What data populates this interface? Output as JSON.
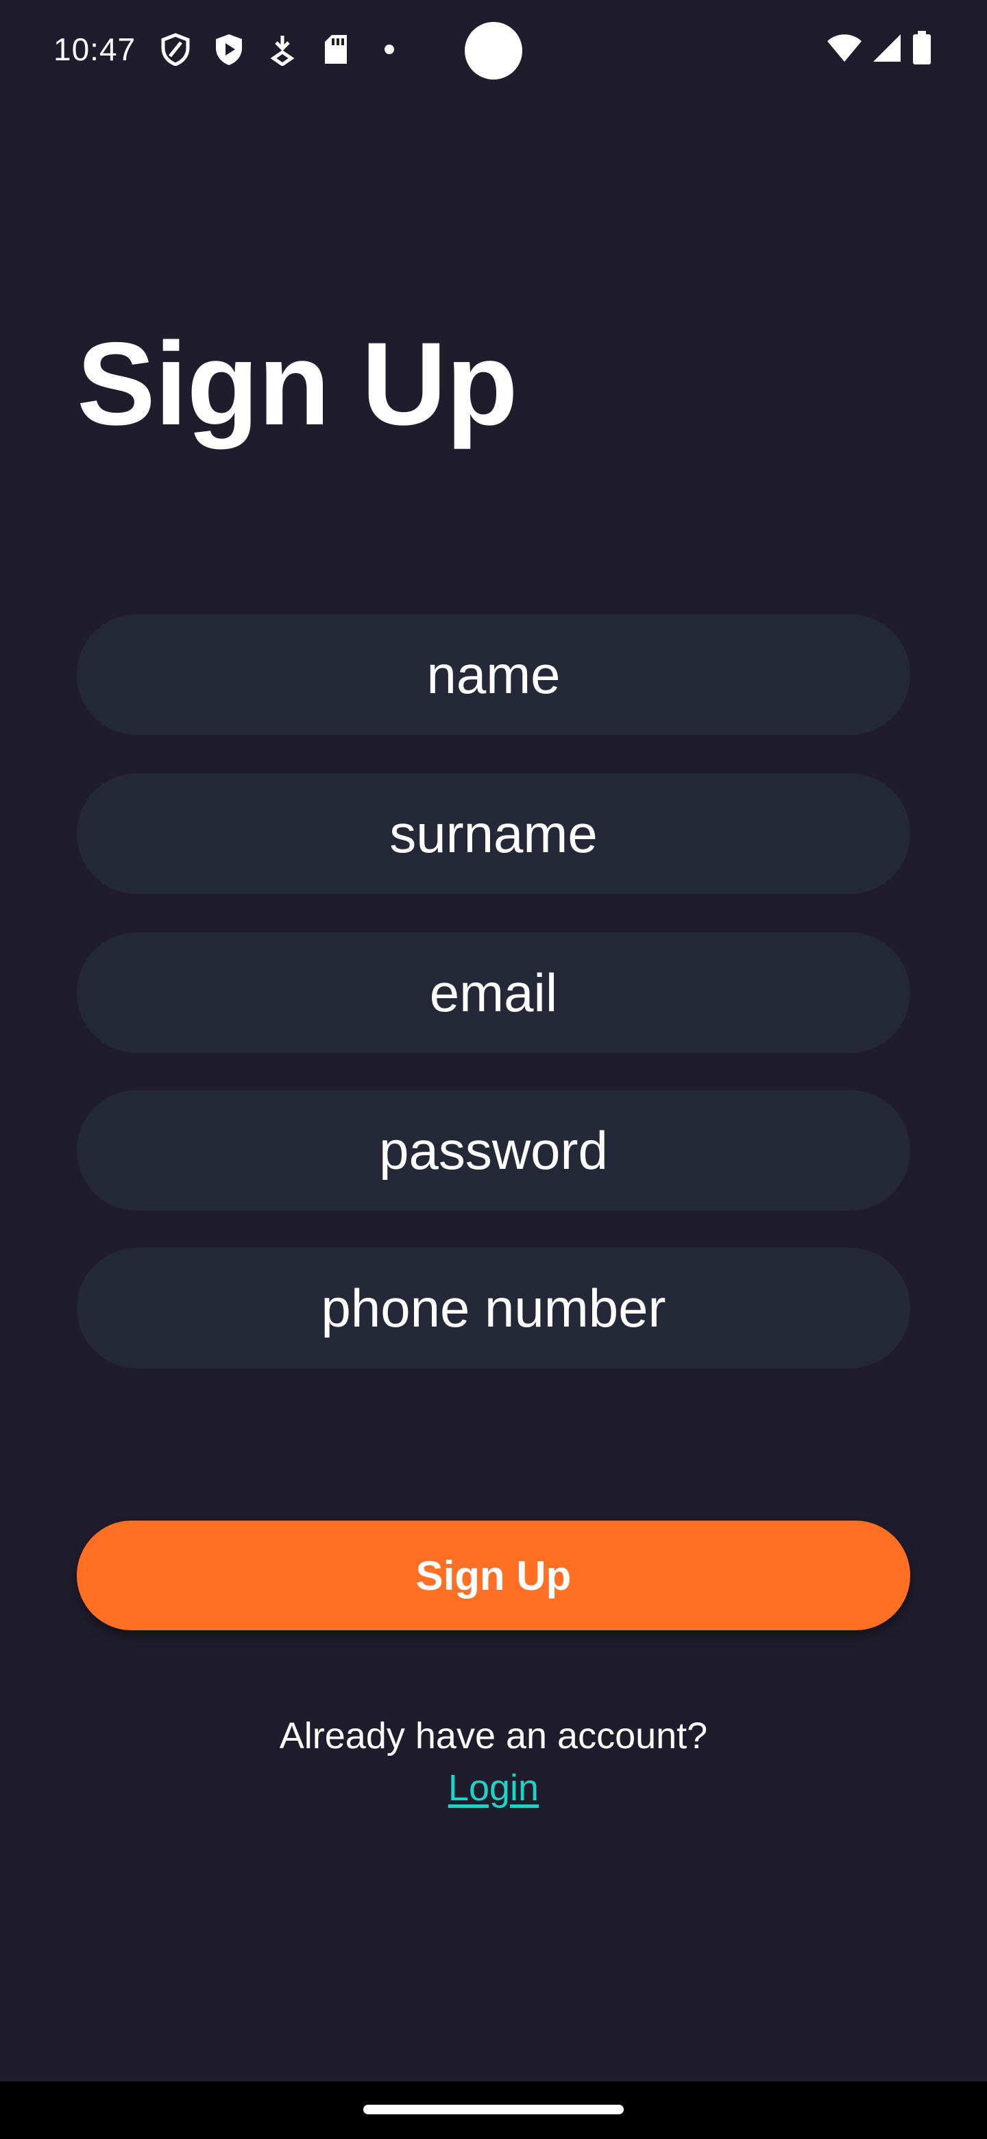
{
  "status_bar": {
    "time": "10:47",
    "left_icons": [
      "shield-outline-icon",
      "play-shield-icon",
      "download-icon",
      "sd-card-icon",
      "dot-icon"
    ],
    "right_icons": [
      "wifi-icon",
      "cellular-signal-icon",
      "battery-icon"
    ]
  },
  "page": {
    "title": "Sign Up"
  },
  "form": {
    "fields": [
      {
        "placeholder": "name"
      },
      {
        "placeholder": "surname"
      },
      {
        "placeholder": "email"
      },
      {
        "placeholder": "password"
      },
      {
        "placeholder": "phone number"
      }
    ],
    "submit_label": "Sign Up"
  },
  "footer": {
    "prompt": "Already have an account?",
    "login_label": "Login"
  },
  "colors": {
    "background": "#1f1d2b",
    "field_background": "#252837",
    "accent": "#ff7024",
    "link": "#1fd3c6"
  }
}
